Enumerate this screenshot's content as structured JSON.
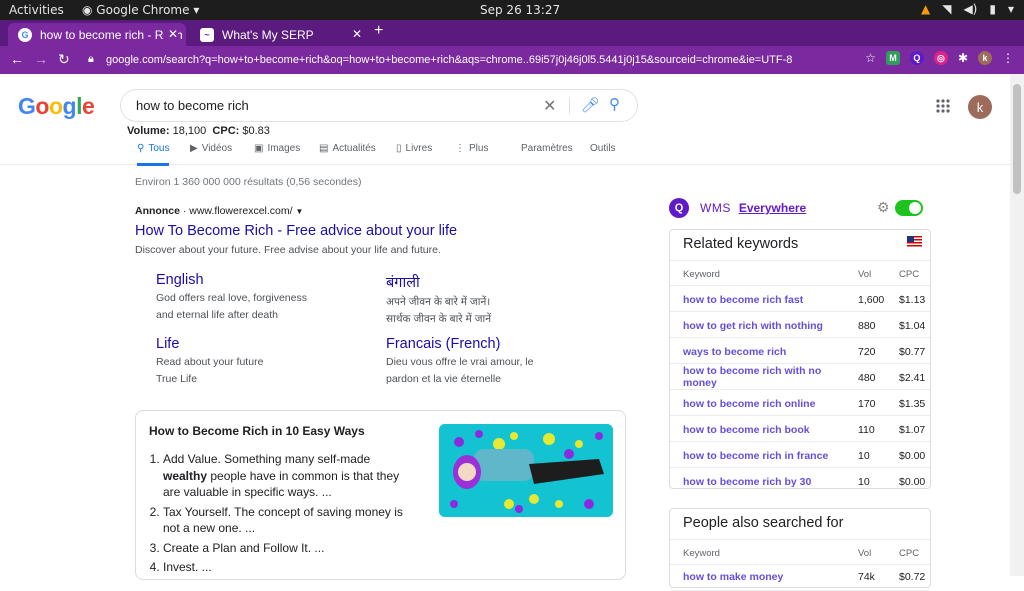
{
  "os_bar": {
    "activities": "Activities",
    "app": "Google Chrome",
    "clock": "Sep 26  13:27"
  },
  "browser": {
    "tabs": [
      {
        "label": "how to become rich - Rech"
      },
      {
        "label": "What's My SERP"
      }
    ],
    "url": "google.com/search?q=how+to+become+rich&oq=how+to+become+rich&aqs=chrome..69i57j0j46j0l5.5441j0j15&sourceid=chrome&ie=UTF-8",
    "profile_initial": "k"
  },
  "google": {
    "logo": "Google",
    "query": "how to become rich",
    "metrics": {
      "volume_label": "Volume:",
      "volume": "18,100",
      "cpc_label": "CPC:",
      "cpc": "$0.83"
    },
    "tabs": [
      "Tous",
      "Vidéos",
      "Images",
      "Actualités",
      "Livres",
      "Plus",
      "Paramètres",
      "Outils"
    ],
    "result_stats": "Environ 1 360 000 000 résultats (0,56 secondes)",
    "ad": {
      "label": "Annonce",
      "domain": "· www.flowerexcel.com/",
      "title": "How To Become Rich - Free advice about your life",
      "description": "Discover about your future. Free advise about your life and future.",
      "sitelinks": [
        {
          "title": "English",
          "line1": "God offers real love, forgiveness",
          "line2": "and eternal life after death"
        },
        {
          "title": "बंगाली",
          "line1": "अपने जीवन के बारे में जानें।",
          "line2": "सार्थक जीवन के बारे में जानें"
        },
        {
          "title": "Life",
          "line1": "Read about your future",
          "line2": "True Life"
        },
        {
          "title": "Francais (French)",
          "line1": "Dieu vous offre le vrai amour, le",
          "line2": "pardon et la vie éternelle"
        }
      ]
    },
    "snippet": {
      "title": "How to Become Rich in 10 Easy Ways",
      "items": [
        {
          "pre": "Add Value. Something many self-made ",
          "bold": "wealthy",
          "post": " people have in common is that they are valuable in specific ways. ..."
        },
        {
          "pre": "Tax Yourself. The concept of saving money is not a new one. ...",
          "bold": "",
          "post": ""
        },
        {
          "pre": "Create a Plan and Follow It. ...",
          "bold": "",
          "post": ""
        },
        {
          "pre": "Invest. ...",
          "bold": "",
          "post": ""
        }
      ]
    }
  },
  "wms": {
    "name": "WMS",
    "everywhere": "Everywhere",
    "related": {
      "title": "Related keywords",
      "headers": {
        "keyword": "Keyword",
        "vol": "Vol",
        "cpc": "CPC"
      },
      "rows": [
        {
          "kw": "how to become rich fast",
          "vol": "1,600",
          "cpc": "$1.13"
        },
        {
          "kw": "how to get rich with nothing",
          "vol": "880",
          "cpc": "$1.04"
        },
        {
          "kw": "ways to become rich",
          "vol": "720",
          "cpc": "$0.77"
        },
        {
          "kw": "how to become rich with no money",
          "vol": "480",
          "cpc": "$2.41"
        },
        {
          "kw": "how to become rich online",
          "vol": "170",
          "cpc": "$1.35"
        },
        {
          "kw": "how to become rich book",
          "vol": "110",
          "cpc": "$1.07"
        },
        {
          "kw": "how to become rich in france",
          "vol": "10",
          "cpc": "$0.00"
        },
        {
          "kw": "how to become rich by 30",
          "vol": "10",
          "cpc": "$0.00"
        }
      ]
    },
    "also": {
      "title": "People also searched for",
      "headers": {
        "keyword": "Keyword",
        "vol": "Vol",
        "cpc": "CPC"
      },
      "rows": [
        {
          "kw": "how to make money",
          "vol": "74k",
          "cpc": "$0.72"
        }
      ]
    }
  }
}
